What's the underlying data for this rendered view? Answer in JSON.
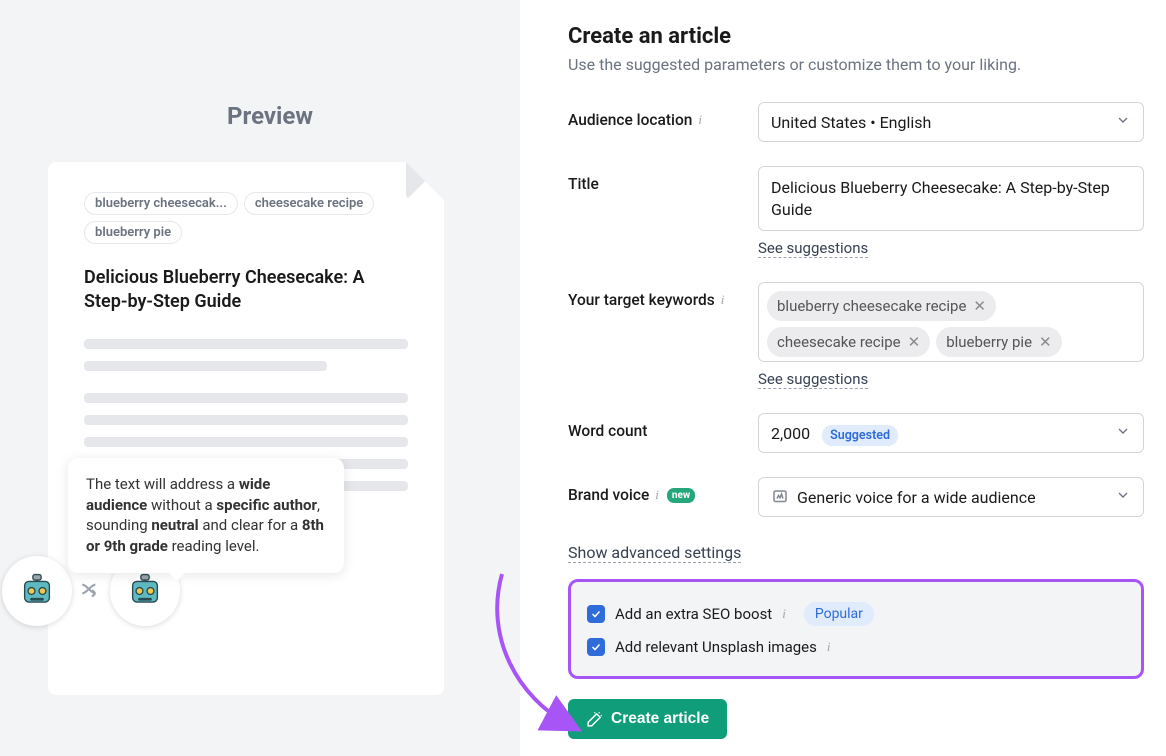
{
  "preview": {
    "heading": "Preview",
    "tags": [
      "blueberry cheesecak...",
      "cheesecake recipe",
      "blueberry pie"
    ],
    "title": "Delicious Blueberry Cheesecake: A Step-by-Step Guide",
    "tooltip_html": "The text will address a <b>wide audience</b> without a <b>specific author</b>, sounding <b>neutral</b> and clear for a <b>8th or 9th grade</b> reading level."
  },
  "header": {
    "title": "Create an article",
    "subtitle": "Use the suggested parameters or customize them to your liking."
  },
  "form": {
    "audience": {
      "label": "Audience location",
      "value": "United States • English"
    },
    "title_field": {
      "label": "Title",
      "value": "Delicious Blueberry Cheesecake: A Step-by-Step Guide",
      "suggestions_link": "See suggestions"
    },
    "keywords": {
      "label": "Your target keywords",
      "chips": [
        "blueberry cheesecake recipe",
        "cheesecake recipe",
        "blueberry pie"
      ],
      "suggestions_link": "See suggestions"
    },
    "word_count": {
      "label": "Word count",
      "value": "2,000",
      "badge": "Suggested"
    },
    "brand_voice": {
      "label": "Brand voice",
      "new_badge": "new",
      "value": "Generic voice for a wide audience"
    },
    "advanced_link": "Show advanced settings",
    "options": {
      "seo": {
        "label": "Add an extra SEO boost",
        "checked": true,
        "badge": "Popular"
      },
      "unsplash": {
        "label": "Add relevant Unsplash images",
        "checked": true
      }
    },
    "submit": "Create article"
  }
}
